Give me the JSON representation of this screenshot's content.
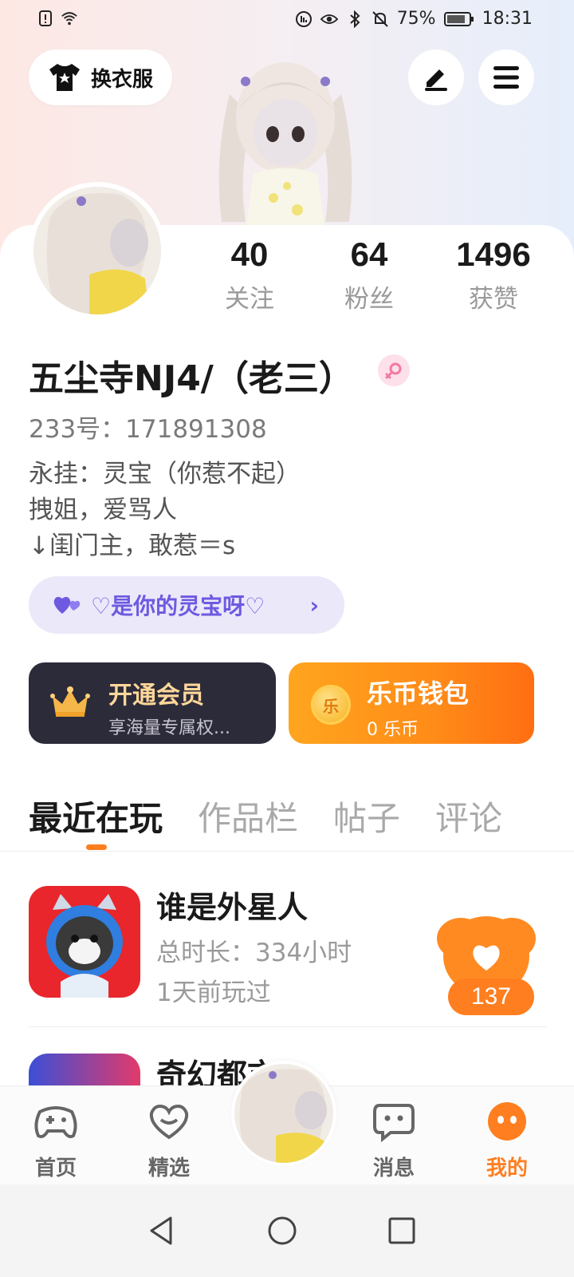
{
  "status_bar": {
    "battery": "75%",
    "time": "18:31"
  },
  "header": {
    "dress_button_label": "换衣服"
  },
  "stats": [
    {
      "value": "40",
      "label": "关注"
    },
    {
      "value": "64",
      "label": "粉丝"
    },
    {
      "value": "1496",
      "label": "获赞"
    }
  ],
  "profile": {
    "name": "五尘寺NJ4/（老三）",
    "gender_icon": "female-icon",
    "uid": "233号：171891308",
    "bio": [
      "永挂：灵宝（你惹不起）",
      "拽姐，爱骂人",
      "↓闺门主，敢惹＝s"
    ]
  },
  "guild": {
    "label": "♡是你的灵宝呀♡"
  },
  "vip": {
    "title": "开通会员",
    "subtitle": "享海量专属权..."
  },
  "wallet": {
    "title": "乐币钱包",
    "subtitle": "0 乐币",
    "coin_char": "乐"
  },
  "tabs": [
    "最近在玩",
    "作品栏",
    "帖子",
    "评论"
  ],
  "games": [
    {
      "title": "谁是外星人",
      "duration": "总时长：334小时",
      "last_played": "1天前玩过",
      "likes": "137"
    },
    {
      "title": "奇幻都市"
    }
  ],
  "bottom_nav": [
    {
      "label": "首页"
    },
    {
      "label": "精选"
    },
    {
      "label": "消息"
    },
    {
      "label": "我的"
    }
  ],
  "colors": {
    "accent": "#ff7e1f",
    "guild": "#6d5ae0",
    "vip_bg": "#2c2b3a"
  }
}
